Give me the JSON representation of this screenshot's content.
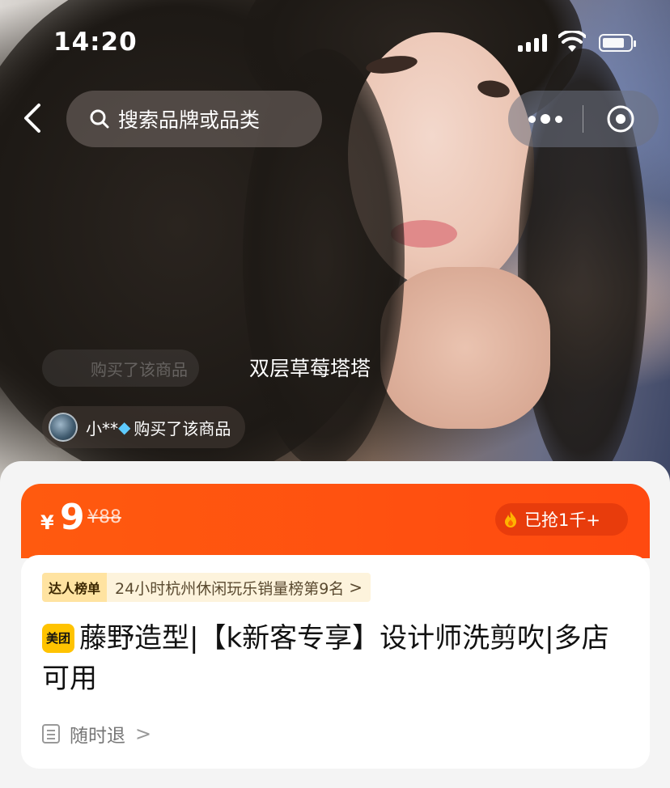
{
  "status_bar": {
    "time": "14:20"
  },
  "nav": {
    "search_placeholder": "搜索品牌或品类"
  },
  "hero": {
    "caption": "双层草莓塔塔",
    "ghost_ticker_text": "购买了该商品",
    "ticker": {
      "user": "小**",
      "action": "购买了该商品"
    }
  },
  "price": {
    "currency": "¥",
    "value": "9",
    "original": "¥88",
    "sold_text": "已抢1千+"
  },
  "ranking": {
    "tag": "达人榜单",
    "text": "24小时杭州休闲玩乐销量榜第9名",
    "chevron": ">"
  },
  "product": {
    "badge": "美团",
    "title": "藤野造型|【k新客专享】设计师洗剪吹|多店可用"
  },
  "policy": {
    "refund_label": "随时退",
    "chevron": ">"
  },
  "colors": {
    "accent_orange": "#ff5a0f",
    "badge_yellow": "#ffc300"
  }
}
